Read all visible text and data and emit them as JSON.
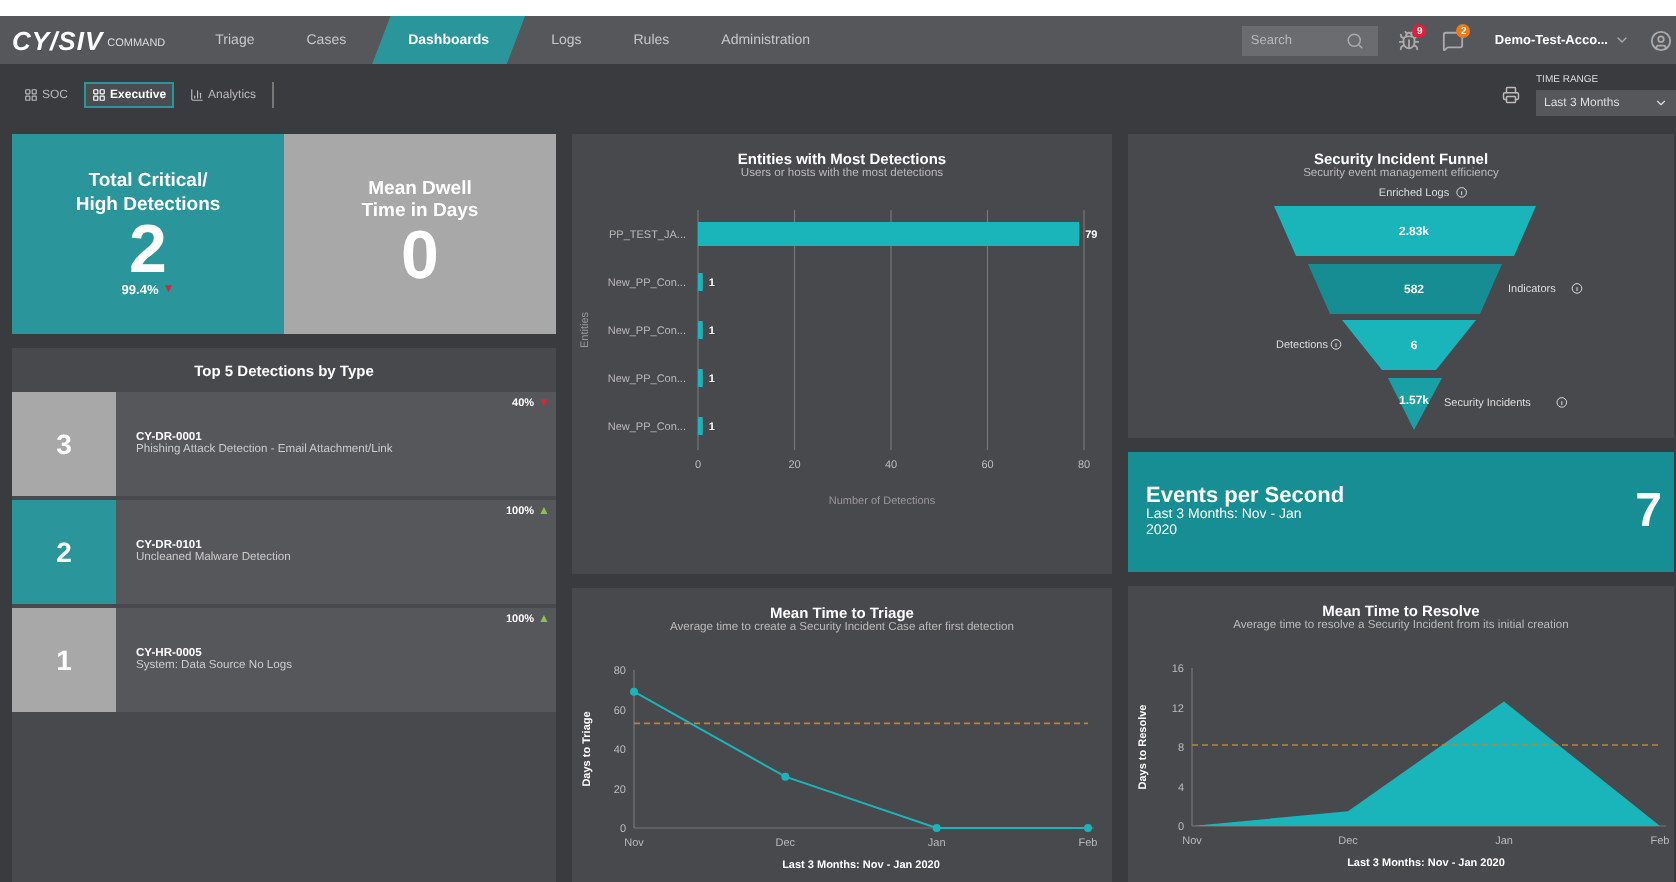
{
  "nav": {
    "logo": "CY/SIV",
    "logo_sub": "COMMAND",
    "items": [
      {
        "label": "Triage",
        "selected": false
      },
      {
        "label": "Cases",
        "selected": false
      },
      {
        "label": "Dashboards",
        "selected": true
      },
      {
        "label": "Logs",
        "selected": false
      },
      {
        "label": "Rules",
        "selected": false
      },
      {
        "label": "Administration",
        "selected": false
      }
    ],
    "search": {
      "placeholder": "Search"
    },
    "alerts": [
      {
        "kind": "bug",
        "count": "9",
        "color": "#e0203a"
      },
      {
        "kind": "message",
        "count": "2",
        "color": "#f07a1a"
      }
    ],
    "account": "Demo-Test-Acco..."
  },
  "subtabs": [
    {
      "label": "SOC",
      "kind": "grid",
      "selected": false
    },
    {
      "label": "Executive",
      "kind": "grid",
      "selected": true
    },
    {
      "label": "Analytics",
      "kind": "bars",
      "selected": false
    }
  ],
  "time_range": {
    "label": "TIME RANGE",
    "value": "Last 3 Months"
  },
  "kpis": [
    {
      "title": "Total Critical/ High Detections",
      "value": "2",
      "change": "99.4%",
      "arrow": "▼",
      "color": "#2a969b"
    },
    {
      "title": "Mean Dwell Time in Days",
      "value": "0",
      "color": "#a8a8a8"
    }
  ],
  "top_detections": {
    "title": "Top 5 Detections by Type",
    "rows": [
      {
        "rank": "3",
        "code": "CY-DR-0001",
        "name": "Phishing Attack Detection - Email Attachment/Link",
        "change": "40%",
        "arrow": "▼",
        "color": "#a8a8a8"
      },
      {
        "rank": "2",
        "code": "CY-DR-0101",
        "name": "Uncleaned Malware Detection",
        "change": "100%",
        "arrow": "▲",
        "color": "#2a969b"
      },
      {
        "rank": "1",
        "code": "CY-HR-0005",
        "name": "System: Data Source No Logs",
        "change": "100%",
        "arrow": "▲",
        "color": "#a8a8a8"
      }
    ]
  },
  "entities": {
    "title": "Entities with Most Detections",
    "subtitle": "Users or hosts with the most detections",
    "chart_data": {
      "type": "bar",
      "orientation": "horizontal",
      "xlabel": "Number of Detections",
      "ylabel": "Entities",
      "categories": [
        "PP_TEST_JA...",
        "New_PP_Con...",
        "New_PP_Con...",
        "New_PP_Con...",
        "New_PP_Con..."
      ],
      "series": [
        {
          "color": "#1ab5bb",
          "values": [
            79,
            1,
            1,
            1,
            1
          ]
        }
      ],
      "xlim": [
        0,
        80
      ],
      "xticks": [
        0,
        20,
        40,
        60,
        80
      ],
      "data_labels": true,
      "grid": true
    }
  },
  "funnel": {
    "title": "Security Incident Funnel",
    "subtitle": "Security event management efficiency",
    "stages": [
      {
        "label": "Enriched Logs",
        "value": "2.83k",
        "color": "#1ab5bb"
      },
      {
        "label": "Indicators",
        "value": "582",
        "color": "#168d92"
      },
      {
        "label": "Detections",
        "value": "6",
        "color": "#1ab5bb"
      },
      {
        "label": "Security Incidents",
        "value": "1.57k",
        "color": "#1a9fa5"
      }
    ]
  },
  "events": {
    "title": "Events per Second",
    "subtitle": "Last 3 Months: Nov - Jan 2020",
    "value": "7"
  },
  "triage": {
    "title": "Mean Time to Triage",
    "subtitle": "Average time to create a Security Incident Case after first detection",
    "chart_data": {
      "type": "line",
      "xlabel": "Last 3 Months: Nov - Jan 2020",
      "ylabel": "Days to Triage",
      "categories": [
        "Nov",
        "Dec",
        "Jan",
        "Feb"
      ],
      "series": [
        {
          "color": "#1ab5bb",
          "values": [
            69,
            26,
            0,
            0
          ],
          "marker": "o"
        }
      ],
      "ylim": [
        0,
        80
      ],
      "yticks": [
        0,
        20,
        40,
        60,
        80
      ],
      "ref_lines": [
        {
          "axis": "y",
          "value": 53,
          "color": "#b8862e"
        }
      ]
    }
  },
  "resolve": {
    "title": "Mean Time to Resolve",
    "subtitle": "Average time to resolve a Security Incident from its initial creation",
    "chart_data": {
      "type": "area",
      "xlabel": "Last 3 Months: Nov - Jan 2020",
      "ylabel": "Days to Resolve",
      "categories": [
        "Nov",
        "Dec",
        "Jan",
        "Feb"
      ],
      "series": [
        {
          "color": "#1ab5bb",
          "values": [
            0,
            1.5,
            12.6,
            0
          ]
        }
      ],
      "ylim": [
        0,
        16
      ],
      "yticks": [
        0,
        4,
        8,
        12,
        16
      ],
      "ref_lines": [
        {
          "axis": "y",
          "value": 8.2,
          "color": "#b8862e"
        }
      ]
    }
  }
}
